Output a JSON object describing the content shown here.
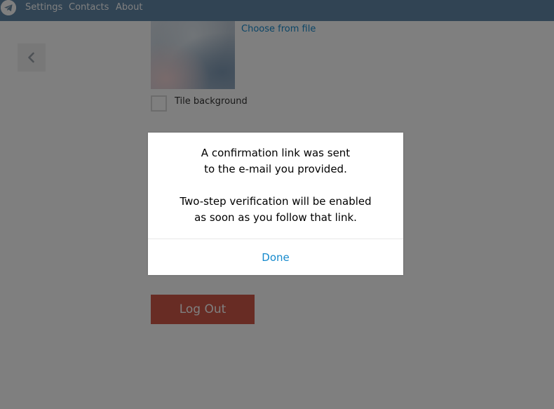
{
  "menu": {
    "items": [
      {
        "label": "Settings"
      },
      {
        "label": "Contacts"
      },
      {
        "label": "About"
      }
    ]
  },
  "logo": {
    "icon": "telegram-plane-icon"
  },
  "back": {
    "icon": "chevron-left-icon"
  },
  "settings": {
    "choose_from_file": "Choose from file",
    "tile_background": "Tile background",
    "tile_background_checked": false,
    "logout_label": "Log Out"
  },
  "modal": {
    "line1": "A confirmation link was sent",
    "line2": "to the e-mail you provided.",
    "line3": "Two-step verification will be enabled",
    "line4": "as soon as you follow that link.",
    "done_label": "Done"
  },
  "colors": {
    "topbar": "#6389a8",
    "accent": "#168acd",
    "logout": "#d15948",
    "overlay": "rgba(0,0,0,0.5)"
  }
}
